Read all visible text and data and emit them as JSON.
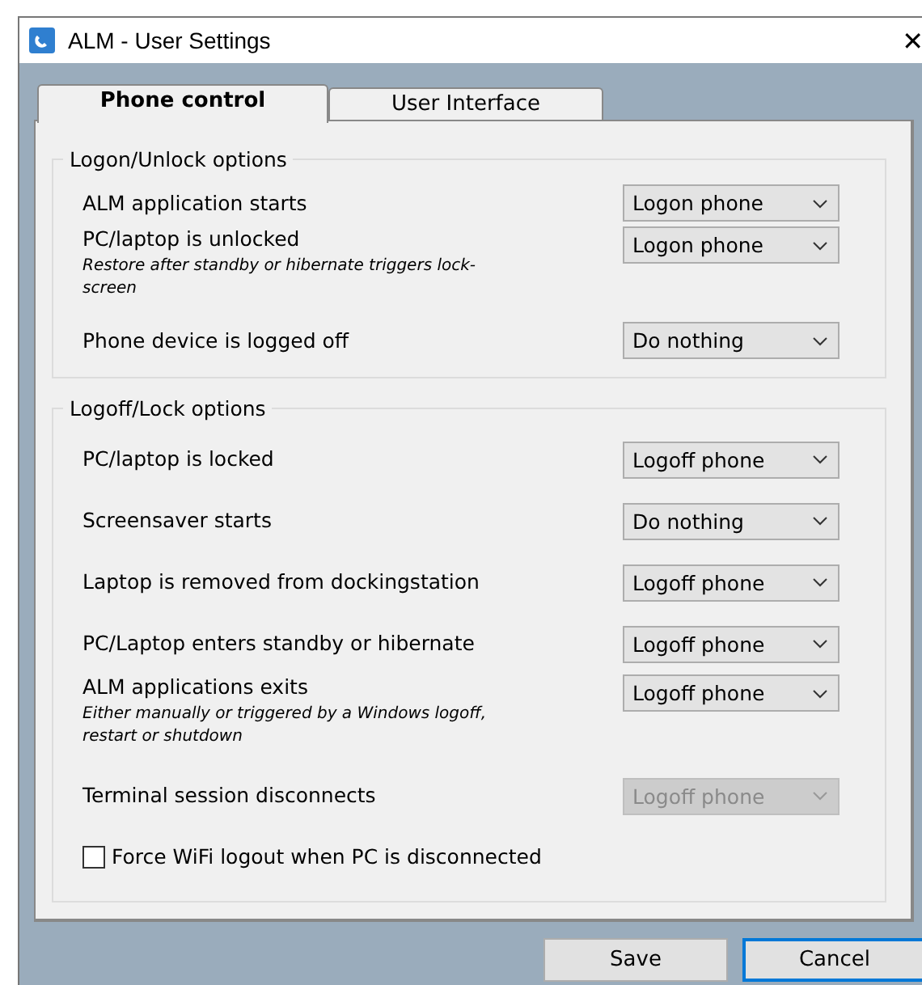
{
  "window": {
    "title": "ALM - User Settings",
    "close": "✕"
  },
  "tabs": [
    {
      "label": "Phone control",
      "selected": true
    },
    {
      "label": "User Interface",
      "selected": false
    }
  ],
  "groups": [
    {
      "title": "Logon/Unlock options",
      "rows": [
        {
          "kind": "dropdown",
          "label": "ALM application starts",
          "value": "Logon phone",
          "disabled": false
        },
        {
          "kind": "dropdown",
          "label": "PC/laptop is unlocked",
          "note": "Restore after standby or hibernate triggers lock-screen",
          "value": "Logon phone",
          "disabled": false
        },
        {
          "kind": "dropdown",
          "label": "Phone device is logged off",
          "value": "Do nothing",
          "disabled": false
        }
      ]
    },
    {
      "title": "Logoff/Lock options",
      "rows": [
        {
          "kind": "dropdown",
          "label": "PC/laptop is locked",
          "value": "Logoff phone",
          "disabled": false
        },
        {
          "kind": "dropdown",
          "label": "Screensaver starts",
          "value": "Do nothing",
          "disabled": false
        },
        {
          "kind": "dropdown",
          "label": "Laptop is removed from dockingstation",
          "value": "Logoff phone",
          "disabled": false
        },
        {
          "kind": "dropdown",
          "label": "PC/Laptop enters standby or hibernate",
          "value": "Logoff phone",
          "disabled": false
        },
        {
          "kind": "dropdown",
          "label": "ALM applications exits",
          "note": "Either manually or triggered by a Windows logoff, restart or shutdown",
          "value": "Logoff phone",
          "disabled": false
        },
        {
          "kind": "dropdown",
          "label": "Terminal session disconnects",
          "value": "Logoff phone",
          "disabled": true
        },
        {
          "kind": "checkbox",
          "label": "Force WiFi logout when PC is disconnected",
          "checked": false
        }
      ]
    }
  ],
  "buttons": [
    {
      "label": "Save",
      "default": false
    },
    {
      "label": "Cancel",
      "default": true
    }
  ]
}
